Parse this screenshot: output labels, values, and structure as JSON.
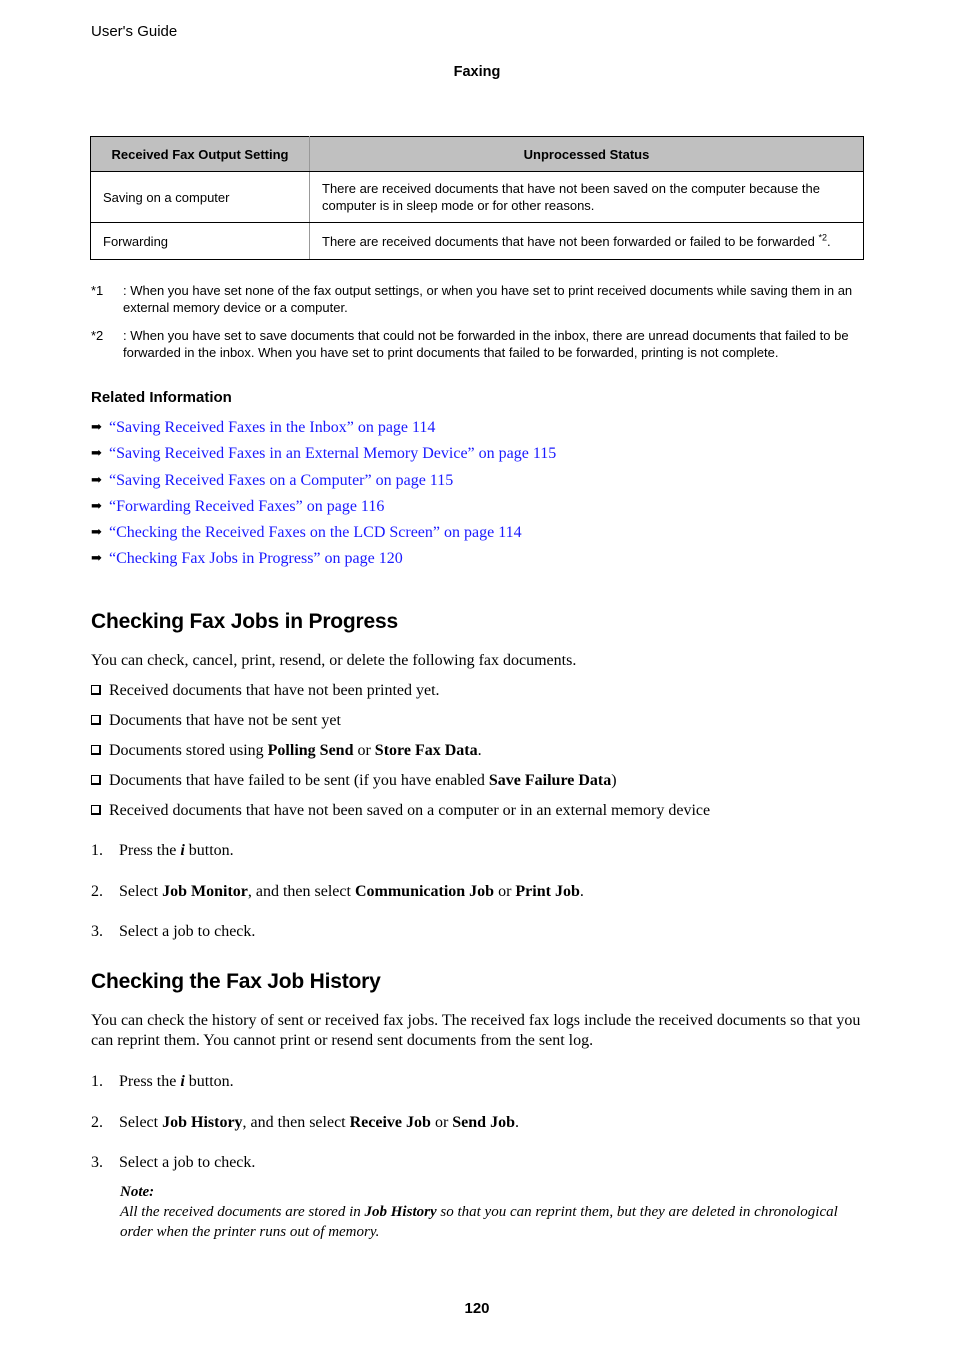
{
  "header": {
    "running_head": "User's Guide",
    "chapter": "Faxing"
  },
  "table": {
    "columns": [
      "Received Fax Output Setting",
      "Unprocessed Status"
    ],
    "rows": [
      {
        "setting": "Saving on a computer",
        "status": "There are received documents that have not been saved on the computer because the computer is in sleep mode or for other reasons.",
        "note": ""
      },
      {
        "setting": "Forwarding",
        "status": "There are received documents that have not been forwarded or failed to be forwarded ",
        "note": "*2"
      }
    ]
  },
  "footnotes": [
    {
      "mark": "*1",
      "text": ": When you have set none of the fax output settings, or when you have set to print received documents while saving them in an external memory device or a computer."
    },
    {
      "mark": "*2",
      "text": ": When you have set to save documents that could not be forwarded in the inbox, there are unread documents that failed to be forwarded in the inbox. When you have set to print documents that failed to be forwarded, printing is not complete."
    }
  ],
  "related": {
    "heading": "Related Information",
    "links": [
      "“Saving Received Faxes in the Inbox” on page 114",
      "“Saving Received Faxes in an External Memory Device” on page 115",
      "“Saving Received Faxes on a Computer” on page 115",
      "“Forwarding Received Faxes” on page 116",
      "“Checking the Received Faxes on the LCD Screen” on page 114",
      "“Checking Fax Jobs in Progress” on page 120"
    ],
    "link_color": "#1a1aff"
  },
  "progress_section": {
    "title": "Checking Fax Jobs in Progress",
    "intro": "You can check, cancel, print, resend, or delete the following fax documents.",
    "items": [
      {
        "pre": "Received documents that have not been printed yet.",
        "b1": "",
        "mid": "",
        "b2": "",
        "post": ""
      },
      {
        "pre": "Documents that have not be sent yet",
        "b1": "",
        "mid": "",
        "b2": "",
        "post": ""
      },
      {
        "pre": "Documents stored using ",
        "b1": "Polling Send",
        "mid": " or ",
        "b2": "Store Fax Data",
        "post": "."
      },
      {
        "pre": "Documents that have failed to be sent (if you have enabled ",
        "b1": "Save Failure Data",
        "mid": ")",
        "b2": "",
        "post": ""
      },
      {
        "pre": "Received documents that have not been saved on a computer or in an external memory device",
        "b1": "",
        "mid": "",
        "b2": "",
        "post": ""
      }
    ],
    "steps": [
      {
        "num": "1.",
        "pre": "Press the ",
        "icon": "i",
        "post": " button."
      },
      {
        "num": "2.",
        "pre": "Select ",
        "b1": "Job Monitor",
        "mid": ", and then select ",
        "b2": "Communication Job",
        "mid2": " or ",
        "b3": "Print Job",
        "post": "."
      },
      {
        "num": "3.",
        "text": "Select a job to check."
      }
    ]
  },
  "history_section": {
    "title": "Checking the Fax Job History",
    "intro": "You can check the history of sent or received fax jobs. The received fax logs include the received documents so that you can reprint them. You cannot print or resend sent documents from the sent log.",
    "steps": [
      {
        "num": "1.",
        "pre": "Press the ",
        "icon": "i",
        "post": " button."
      },
      {
        "num": "2.",
        "pre": "Select ",
        "b1": "Job History",
        "mid": ", and then select ",
        "b2": "Receive Job",
        "mid2": " or ",
        "b3": "Send Job",
        "post": "."
      },
      {
        "num": "3.",
        "text": "Select a job to check."
      }
    ],
    "note": {
      "label": "Note:",
      "pre": "All the received documents are stored in ",
      "bold": "Job History",
      "post": " so that you can reprint them, but they are deleted in chronological order when the printer runs out of memory."
    }
  },
  "footer": {
    "page_number": "120"
  }
}
